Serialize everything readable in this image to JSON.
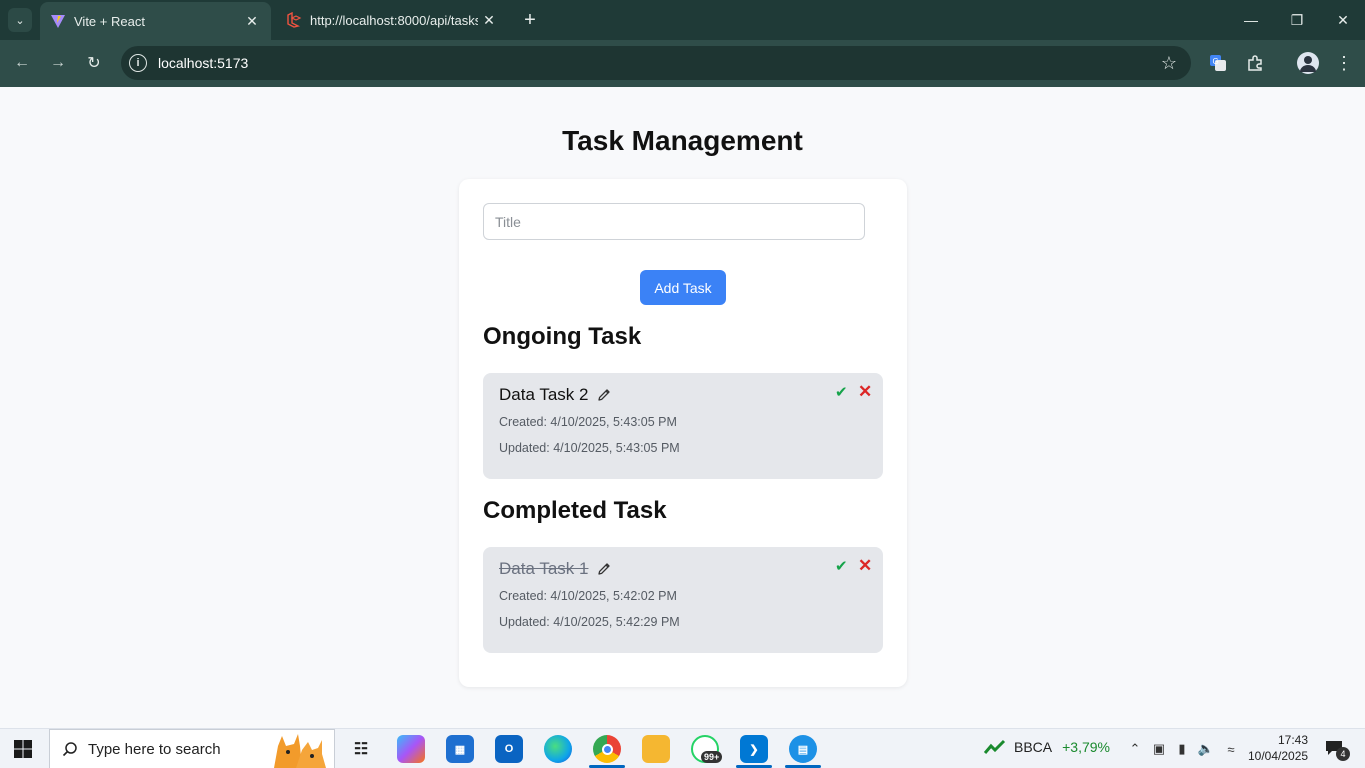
{
  "browser": {
    "tabs": [
      {
        "title": "Vite + React",
        "active": true
      },
      {
        "title": "http://localhost:8000/api/tasks",
        "active": false
      }
    ],
    "url": "localhost:5173"
  },
  "app": {
    "heading": "Task Management",
    "title_placeholder": "Title",
    "add_button": "Add Task",
    "ongoing_heading": "Ongoing Task",
    "completed_heading": "Completed Task",
    "ongoing_tasks": [
      {
        "title": "Data Task 2",
        "created": "Created: 4/10/2025, 5:43:05 PM",
        "updated": "Updated: 4/10/2025, 5:43:05 PM"
      }
    ],
    "completed_tasks": [
      {
        "title": "Data Task 1",
        "created": "Created: 4/10/2025, 5:42:02 PM",
        "updated": "Updated: 4/10/2025, 5:42:29 PM"
      }
    ],
    "colors": {
      "accent": "#3b82f6",
      "complete": "#16a34a",
      "delete": "#dc2626",
      "task_bg": "#e5e7eb"
    }
  },
  "taskbar": {
    "search_placeholder": "Type here to search",
    "whatsapp_badge": "99+",
    "stock_name": "BBCA",
    "stock_change": "+3,79%",
    "time": "17:43",
    "date": "10/04/2025",
    "notification_count": "4"
  }
}
